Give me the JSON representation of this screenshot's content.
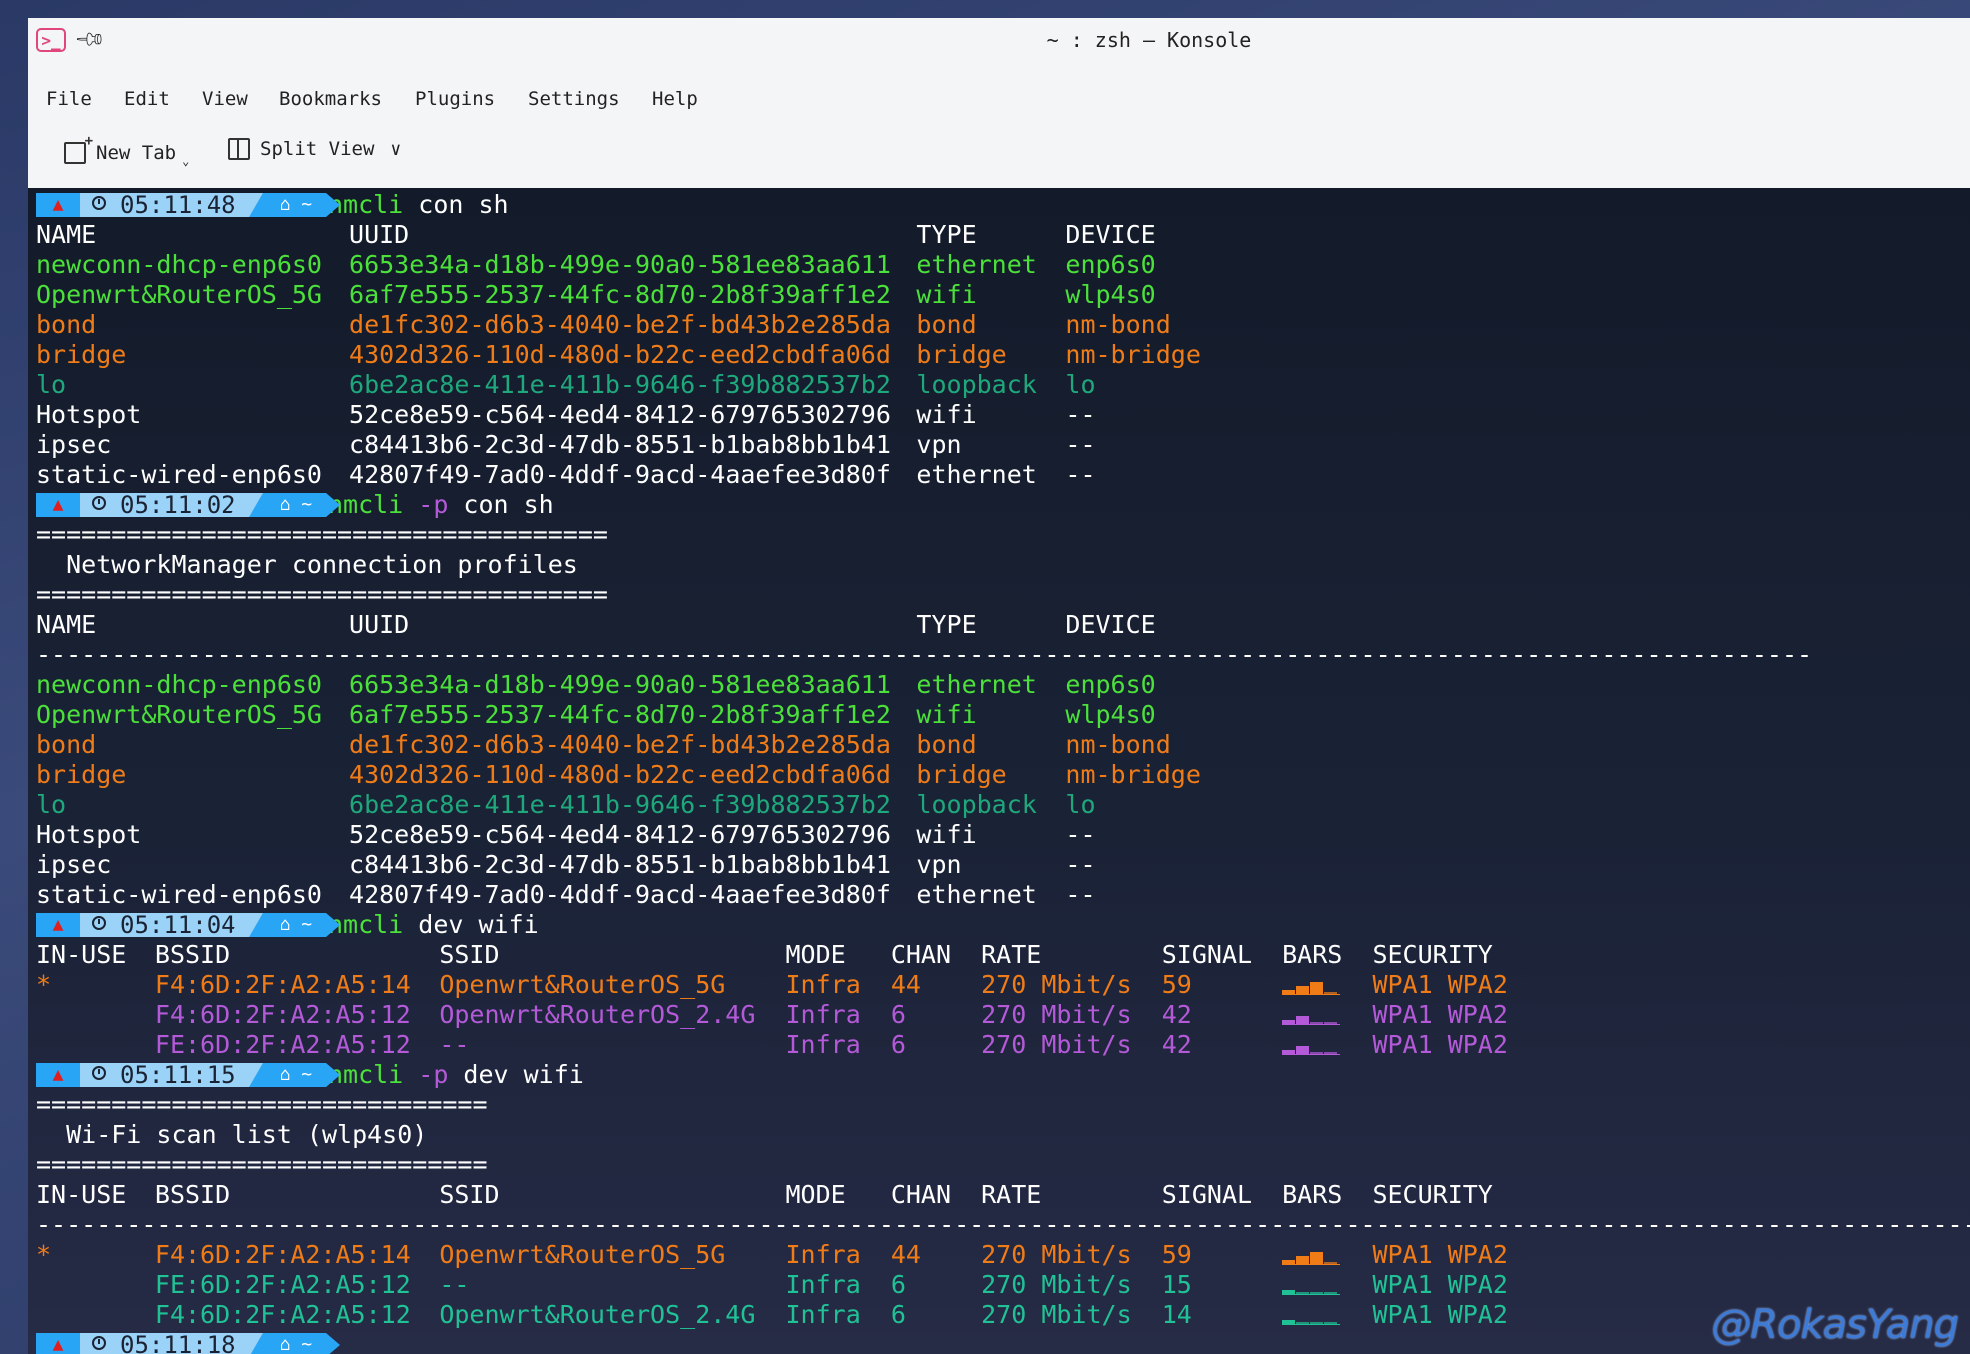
{
  "window": {
    "title": "~ : zsh — Konsole"
  },
  "menu": [
    "File",
    "Edit",
    "View",
    "Bookmarks",
    "Plugins",
    "Settings",
    "Help"
  ],
  "toolbar": {
    "new_tab": "New Tab",
    "split_view": "Split View"
  },
  "colors": {
    "green": "#4be03a",
    "orange": "#f07c18",
    "teal": "#1fa87c",
    "purple": "#b45ad8",
    "white": "#ffffff"
  },
  "terminal": {
    "prompts": [
      {
        "time": "05:11:48",
        "cmd": "nmcli",
        "flag": "",
        "args": "con sh"
      },
      {
        "time": "05:11:02",
        "cmd": "nmcli",
        "flag": "-p",
        "args": "con sh"
      },
      {
        "time": "05:11:04",
        "cmd": "nmcli",
        "flag": "",
        "args": "dev wifi"
      },
      {
        "time": "05:11:15",
        "cmd": "nmcli",
        "flag": "-p",
        "args": "dev wifi"
      },
      {
        "time": "05:11:18",
        "cmd": "",
        "flag": "",
        "args": "_"
      }
    ],
    "home": "~",
    "con_headers": [
      "NAME",
      "UUID",
      "TYPE",
      "DEVICE"
    ],
    "connections": [
      {
        "name": "newconn-dhcp-enp6s0",
        "uuid": "6653e34a-d18b-499e-90a0-581ee83aa611",
        "type": "ethernet",
        "device": "enp6s0",
        "color": "g"
      },
      {
        "name": "Openwrt&RouterOS_5G",
        "uuid": "6af7e555-2537-44fc-8d70-2b8f39aff1e2",
        "type": "wifi",
        "device": "wlp4s0",
        "color": "g"
      },
      {
        "name": "bond",
        "uuid": "de1fc302-d6b3-4040-be2f-bd43b2e285da",
        "type": "bond",
        "device": "nm-bond",
        "color": "o"
      },
      {
        "name": "bridge",
        "uuid": "4302d326-110d-480d-b22c-eed2cbdfa06d",
        "type": "bridge",
        "device": "nm-bridge",
        "color": "o"
      },
      {
        "name": "lo",
        "uuid": "6be2ac8e-411e-411b-9646-f39b882537b2",
        "type": "loopback",
        "device": "lo",
        "color": "t"
      },
      {
        "name": "Hotspot",
        "uuid": "52ce8e59-c564-4ed4-8412-679765302796",
        "type": "wifi",
        "device": "--",
        "color": "w"
      },
      {
        "name": "ipsec",
        "uuid": "c84413b6-2c3d-47db-8551-b1bab8bb1b41",
        "type": "vpn",
        "device": "--",
        "color": "w"
      },
      {
        "name": "static-wired-enp6s0",
        "uuid": "42807f49-7ad0-4ddf-9acd-4aaefee3d80f",
        "type": "ethernet",
        "device": "--",
        "color": "w"
      }
    ],
    "con_pretty_rule": "======================================",
    "con_pretty_title": "  NetworkManager connection profiles",
    "con_dash_rule": "----------------------------------------------------------------------------------------------------------------------",
    "wifi_headers": [
      "IN-USE",
      "BSSID",
      "SSID",
      "MODE",
      "CHAN",
      "RATE",
      "SIGNAL",
      "BARS",
      "SECURITY"
    ],
    "wifi_scan1": [
      {
        "inuse": "*",
        "bssid": "F4:6D:2F:A2:A5:14",
        "ssid": "Openwrt&RouterOS_5G",
        "mode": "Infra",
        "chan": "44",
        "rate": "270 Mbit/s",
        "signal": "59",
        "bars": 0.59,
        "security": "WPA1 WPA2",
        "color": "o"
      },
      {
        "inuse": "",
        "bssid": "F4:6D:2F:A2:A5:12",
        "ssid": "Openwrt&RouterOS_2.4G",
        "mode": "Infra",
        "chan": "6",
        "rate": "270 Mbit/s",
        "signal": "42",
        "bars": 0.42,
        "security": "WPA1 WPA2",
        "color": "p"
      },
      {
        "inuse": "",
        "bssid": "FE:6D:2F:A2:A5:12",
        "ssid": "--",
        "mode": "Infra",
        "chan": "6",
        "rate": "270 Mbit/s",
        "signal": "42",
        "bars": 0.42,
        "security": "WPA1 WPA2",
        "color": "p"
      }
    ],
    "wifi_pretty_rule": "==============================",
    "wifi_pretty_title": "  Wi-Fi scan list (wlp4s0)",
    "wifi_dash_rule": "------------------------------------------------------------------------------------------------------------------------------------",
    "wifi_scan2": [
      {
        "inuse": "*",
        "bssid": "F4:6D:2F:A2:A5:14",
        "ssid": "Openwrt&RouterOS_5G",
        "mode": "Infra",
        "chan": "44",
        "rate": "270 Mbit/s",
        "signal": "59",
        "bars": 0.59,
        "security": "WPA1 WPA2",
        "color": "o"
      },
      {
        "inuse": "",
        "bssid": "FE:6D:2F:A2:A5:12",
        "ssid": "--",
        "mode": "Infra",
        "chan": "6",
        "rate": "270 Mbit/s",
        "signal": "15",
        "bars": 0.15,
        "security": "WPA1 WPA2",
        "color": "tq"
      },
      {
        "inuse": "",
        "bssid": "F4:6D:2F:A2:A5:12",
        "ssid": "Openwrt&RouterOS_2.4G",
        "mode": "Infra",
        "chan": "6",
        "rate": "270 Mbit/s",
        "signal": "14",
        "bars": 0.14,
        "security": "WPA1 WPA2",
        "color": "tq"
      }
    ],
    "watermark": "@RokasYang"
  }
}
